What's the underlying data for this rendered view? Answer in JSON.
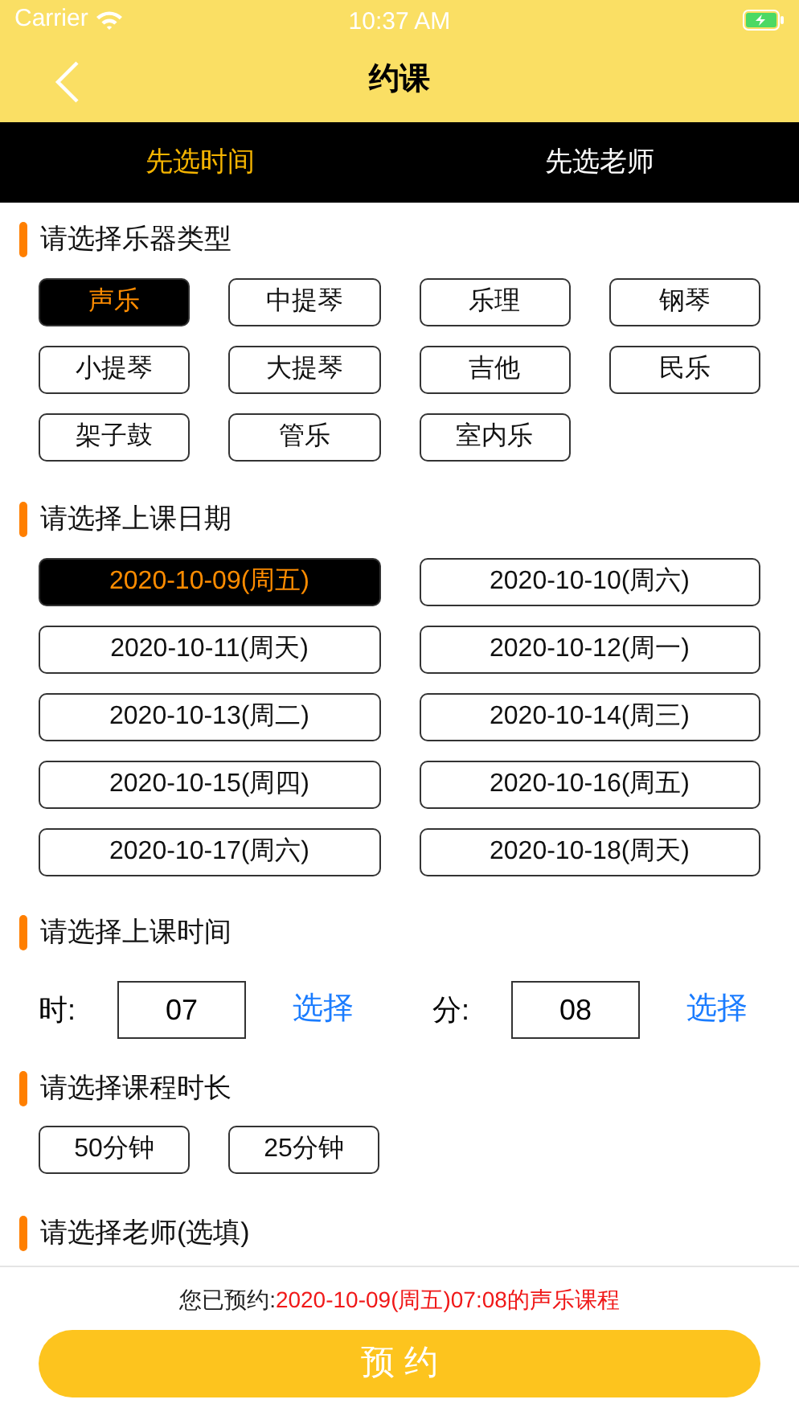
{
  "status_bar": {
    "carrier": "Carrier",
    "time": "10:37 AM"
  },
  "nav": {
    "title": "约课"
  },
  "tabs": [
    {
      "label": "先选时间",
      "selected": true
    },
    {
      "label": "先选老师",
      "selected": false
    }
  ],
  "instruments": {
    "title": "请选择乐器类型",
    "options": [
      {
        "label": "声乐",
        "selected": true
      },
      {
        "label": "中提琴",
        "selected": false
      },
      {
        "label": "乐理",
        "selected": false
      },
      {
        "label": "钢琴",
        "selected": false
      },
      {
        "label": "小提琴",
        "selected": false
      },
      {
        "label": "大提琴",
        "selected": false
      },
      {
        "label": "吉他",
        "selected": false
      },
      {
        "label": "民乐",
        "selected": false
      },
      {
        "label": "架子鼓",
        "selected": false
      },
      {
        "label": "管乐",
        "selected": false
      },
      {
        "label": "室内乐",
        "selected": false
      }
    ]
  },
  "dates": {
    "title": "请选择上课日期",
    "options": [
      {
        "label": "2020-10-09(周五)",
        "selected": true
      },
      {
        "label": "2020-10-10(周六)",
        "selected": false
      },
      {
        "label": "2020-10-11(周天)",
        "selected": false
      },
      {
        "label": "2020-10-12(周一)",
        "selected": false
      },
      {
        "label": "2020-10-13(周二)",
        "selected": false
      },
      {
        "label": "2020-10-14(周三)",
        "selected": false
      },
      {
        "label": "2020-10-15(周四)",
        "selected": false
      },
      {
        "label": "2020-10-16(周五)",
        "selected": false
      },
      {
        "label": "2020-10-17(周六)",
        "selected": false
      },
      {
        "label": "2020-10-18(周天)",
        "selected": false
      }
    ]
  },
  "time": {
    "title": "请选择上课时间",
    "fields": [
      {
        "label": "时:",
        "value": "07",
        "action": "选择"
      },
      {
        "label": "分:",
        "value": "08",
        "action": "选择"
      }
    ]
  },
  "duration": {
    "title": "请选择课程时长",
    "options": [
      {
        "label": "50分钟",
        "selected": false
      },
      {
        "label": "25分钟",
        "selected": false
      }
    ]
  },
  "teacher": {
    "title": "请选择老师(选填)"
  },
  "footer": {
    "summary_prefix": "您已预约:",
    "summary_detail": "2020-10-09(周五)07:08的声乐课程",
    "button": "预 约"
  }
}
